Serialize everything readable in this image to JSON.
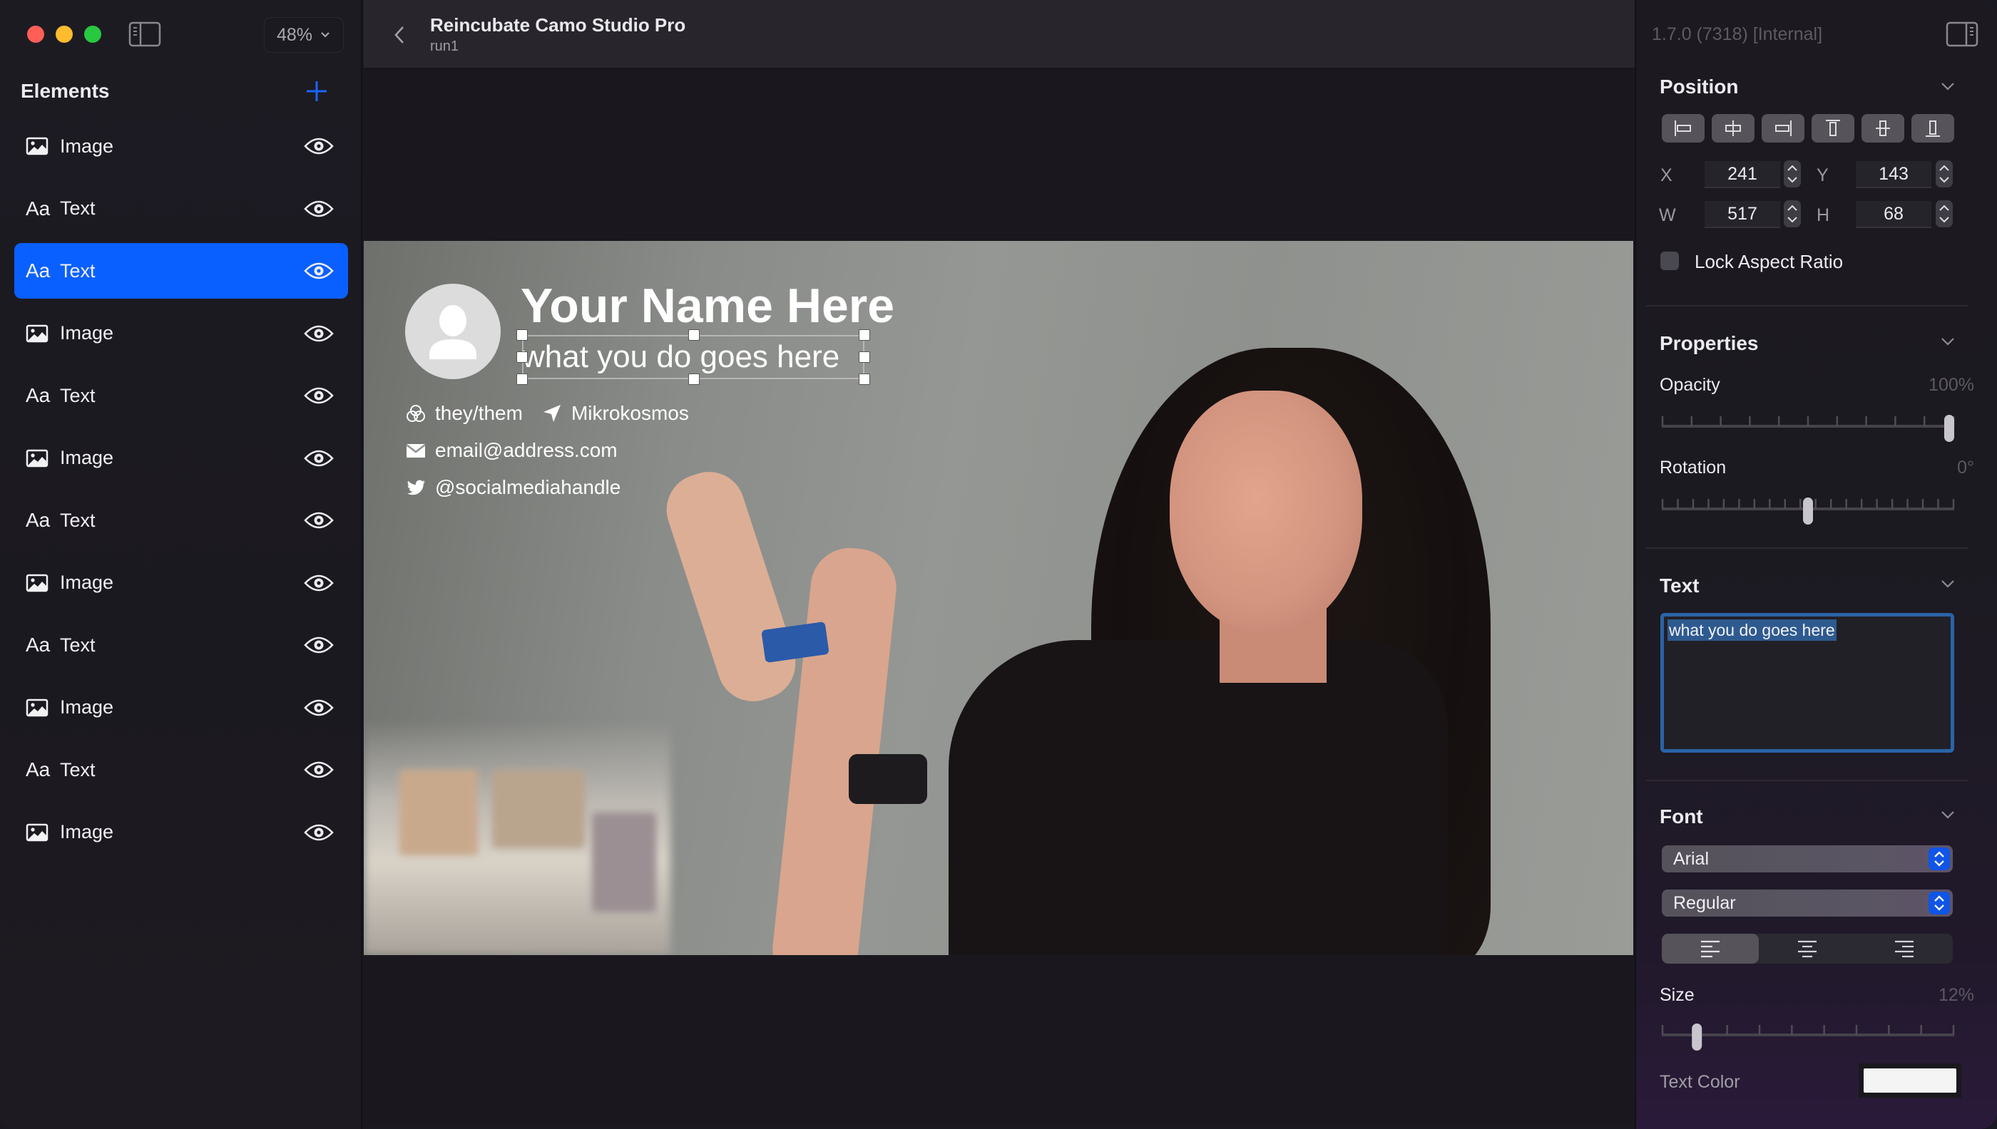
{
  "window": {
    "zoom_level": "48%"
  },
  "sidebar": {
    "title": "Elements",
    "add_label": "+",
    "items": [
      {
        "type": "image",
        "icon": "image-icon",
        "label": "Image",
        "visible": true,
        "selected": false
      },
      {
        "type": "text",
        "icon": "text-icon",
        "glyph": "Aa",
        "label": "Text",
        "visible": true,
        "selected": false
      },
      {
        "type": "text",
        "icon": "text-icon",
        "glyph": "Aa",
        "label": "Text",
        "visible": true,
        "selected": true
      },
      {
        "type": "image",
        "icon": "image-icon",
        "label": "Image",
        "visible": true,
        "selected": false
      },
      {
        "type": "text",
        "icon": "text-icon",
        "glyph": "Aa",
        "label": "Text",
        "visible": true,
        "selected": false
      },
      {
        "type": "image",
        "icon": "image-icon",
        "label": "Image",
        "visible": true,
        "selected": false
      },
      {
        "type": "text",
        "icon": "text-icon",
        "glyph": "Aa",
        "label": "Text",
        "visible": true,
        "selected": false
      },
      {
        "type": "image",
        "icon": "image-icon",
        "label": "Image",
        "visible": true,
        "selected": false
      },
      {
        "type": "text",
        "icon": "text-icon",
        "glyph": "Aa",
        "label": "Text",
        "visible": true,
        "selected": false
      },
      {
        "type": "image",
        "icon": "image-icon",
        "label": "Image",
        "visible": true,
        "selected": false
      },
      {
        "type": "text",
        "icon": "text-icon",
        "glyph": "Aa",
        "label": "Text",
        "visible": true,
        "selected": false
      },
      {
        "type": "image",
        "icon": "image-icon",
        "label": "Image",
        "visible": true,
        "selected": false
      }
    ]
  },
  "header": {
    "title": "Reincubate Camo Studio Pro",
    "subtitle": "run1"
  },
  "canvas": {
    "name": "Your Name Here",
    "role": "what you do goes here",
    "pronouns": "they/them",
    "location": "Mikrokosmos",
    "email": "email@address.com",
    "social": "@socialmediahandle"
  },
  "inspector": {
    "version": "1.7.0 (7318) [Internal]",
    "position": {
      "title": "Position",
      "align_buttons": [
        "align-left",
        "align-center-horizontal",
        "align-right",
        "align-top",
        "align-center-vertical",
        "align-bottom"
      ],
      "x_label": "X",
      "x": "241",
      "y_label": "Y",
      "y": "143",
      "w_label": "W",
      "w": "517",
      "h_label": "H",
      "h": "68",
      "lock_aspect_label": "Lock Aspect Ratio",
      "lock_aspect": false
    },
    "properties": {
      "title": "Properties",
      "opacity_label": "Opacity",
      "opacity_value": "100%",
      "opacity_fraction": 1.0,
      "rotation_label": "Rotation",
      "rotation_value": "0°",
      "rotation_fraction": 0.5
    },
    "text": {
      "title": "Text",
      "value": "what you do goes here"
    },
    "font": {
      "title": "Font",
      "family": "Arial",
      "style": "Regular",
      "alignment": "left",
      "alignment_options": [
        "left",
        "center",
        "right"
      ],
      "size_label": "Size",
      "size_value": "12%",
      "size_fraction": 0.12,
      "text_color_label": "Text Color",
      "text_color": "#f4f4f4"
    }
  },
  "colors": {
    "accent": "#0a60ff",
    "selection_border": "#2a64a6",
    "popup_arrow": "#1055e6"
  }
}
